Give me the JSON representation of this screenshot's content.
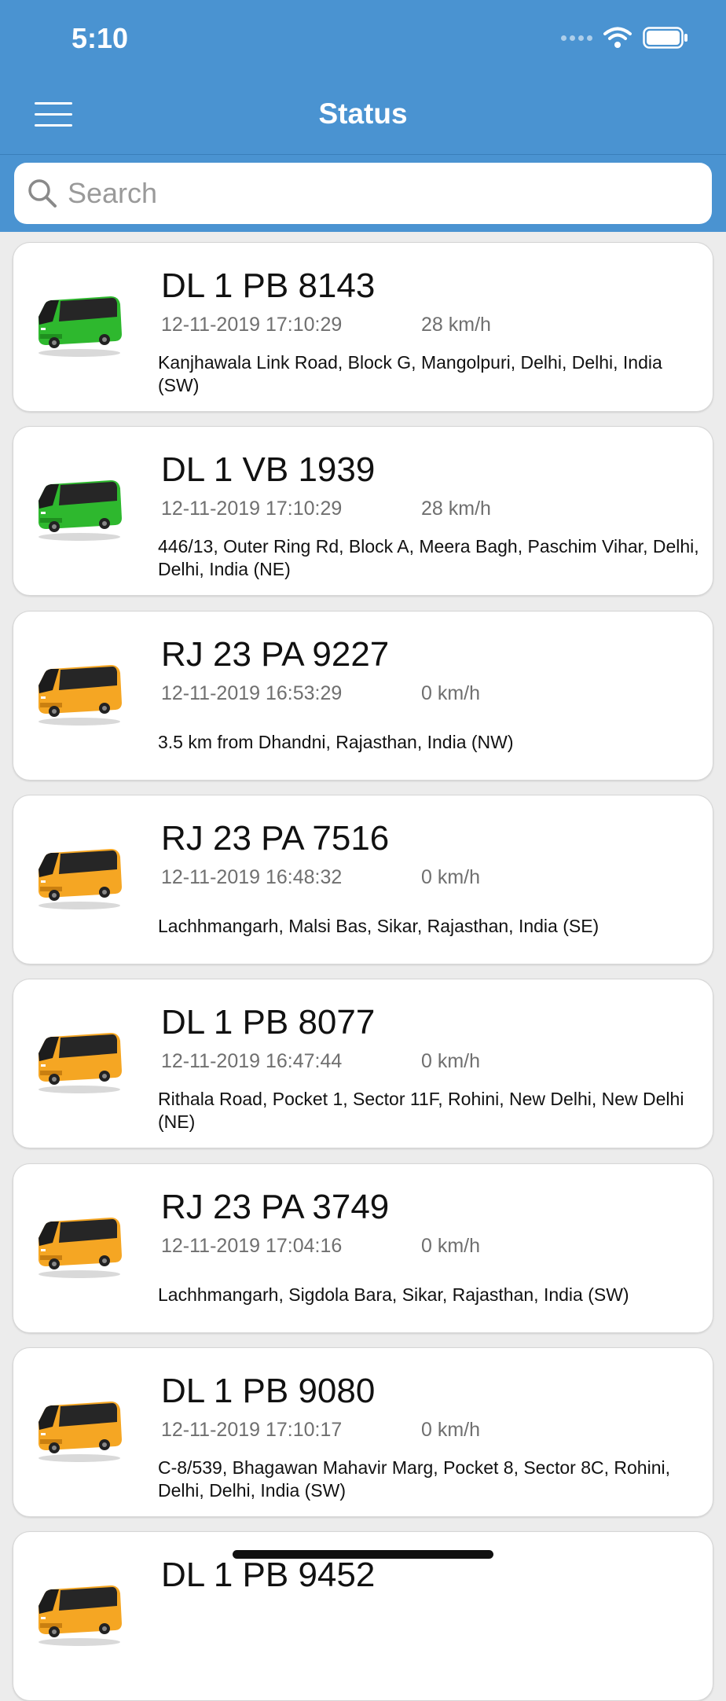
{
  "status_bar": {
    "time": "5:10"
  },
  "header": {
    "title": "Status"
  },
  "search": {
    "placeholder": "Search"
  },
  "colors": {
    "header": "#4a93d1",
    "bus_moving": "#2eb82e",
    "bus_stopped": "#f5a623"
  },
  "vehicles": [
    {
      "plate": "DL 1 PB 8143",
      "timestamp": "12-11-2019 17:10:29",
      "speed": "28 km/h",
      "address": "Kanjhawala Link Road, Block G, Mangolpuri, Delhi, Delhi,  India (SW)",
      "bus_icon": "bus-green-icon"
    },
    {
      "plate": "DL 1 VB 1939",
      "timestamp": "12-11-2019 17:10:29",
      "speed": "28 km/h",
      "address": "446/13, Outer Ring Rd, Block A, Meera Bagh, Paschim Vihar, Delhi, Delhi,  India (NE)",
      "bus_icon": "bus-green-icon"
    },
    {
      "plate": "RJ 23 PA 9227",
      "timestamp": "12-11-2019 16:53:29",
      "speed": "0 km/h",
      "address": "3.5 km from Dhandni, Rajasthan, India (NW)",
      "bus_icon": "bus-orange-icon"
    },
    {
      "plate": "RJ 23 PA 7516",
      "timestamp": "12-11-2019 16:48:32",
      "speed": "0 km/h",
      "address": "Lachhmangarh, Malsi Bas, Sikar, Rajasthan, India (SE)",
      "bus_icon": "bus-orange-icon"
    },
    {
      "plate": "DL 1 PB 8077",
      "timestamp": "12-11-2019 16:47:44",
      "speed": "0 km/h",
      "address": "Rithala Road, Pocket 1, Sector 11F, Rohini, New Delhi, New Delhi (NE)",
      "bus_icon": "bus-orange-icon"
    },
    {
      "plate": "RJ 23 PA 3749",
      "timestamp": "12-11-2019 17:04:16",
      "speed": "0 km/h",
      "address": "Lachhmangarh, Sigdola Bara, Sikar, Rajasthan, India (SW)",
      "bus_icon": "bus-orange-icon"
    },
    {
      "plate": "DL 1 PB 9080",
      "timestamp": "12-11-2019 17:10:17",
      "speed": "0 km/h",
      "address": "C-8/539, Bhagawan Mahavir Marg, Pocket 8, Sector 8C, Rohini, Delhi, Delhi,  India (SW)",
      "bus_icon": "bus-orange-icon"
    },
    {
      "plate": "DL 1 PB 9452",
      "timestamp": "",
      "speed": "",
      "address": "",
      "bus_icon": "bus-orange-icon"
    }
  ]
}
